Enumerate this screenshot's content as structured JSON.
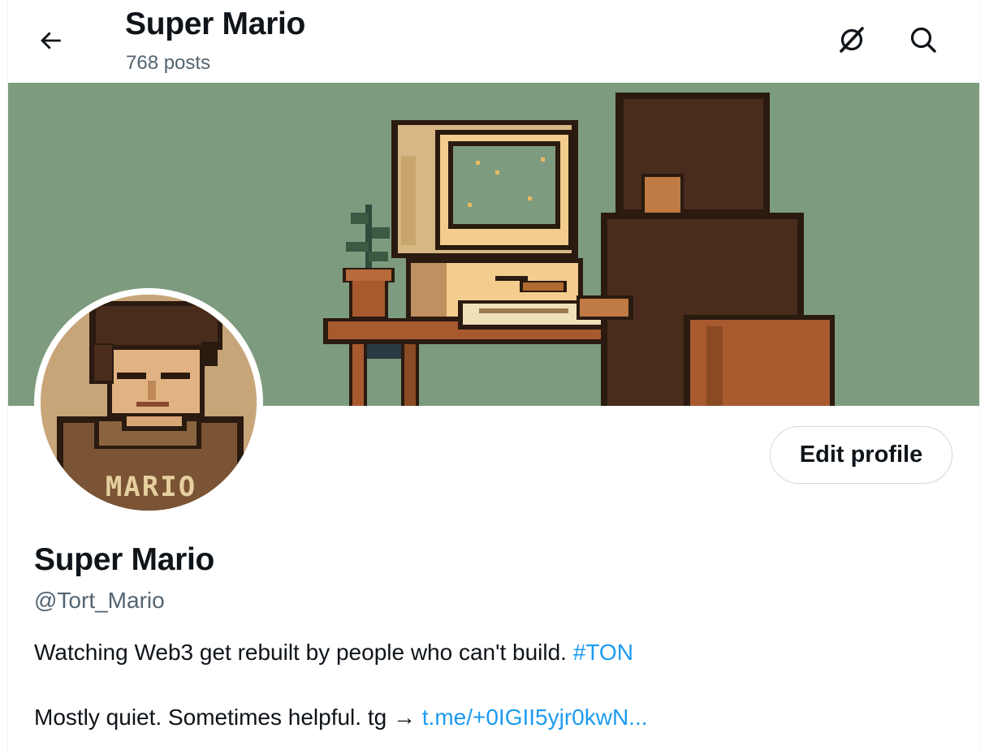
{
  "header": {
    "title": "Super Mario",
    "post_count": "768 posts"
  },
  "profile": {
    "name": "Super Mario",
    "handle": "@Tort_Mario",
    "edit_button": "Edit profile",
    "avatar_hoodie_text": "MARIO",
    "bio": {
      "line1_text": "Watching Web3 get rebuilt by people who can't build.",
      "line1_hashtag": "#TON",
      "line2_text": "Mostly quiet. Sometimes helpful. tg →",
      "line2_link": "t.me/+0IGII5yjr0kwN..."
    }
  },
  "icons": {
    "back": "back-arrow-icon",
    "grok": "grok-icon",
    "search": "search-icon"
  },
  "colors": {
    "link": "#1d9bf0",
    "secondary_text": "#536471",
    "banner_bg": "#7d9b7e"
  }
}
